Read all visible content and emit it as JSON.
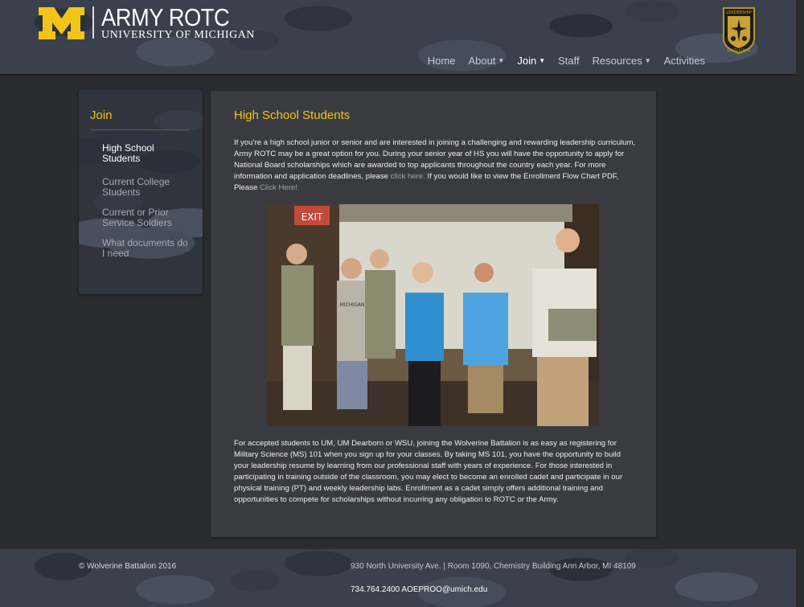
{
  "header": {
    "logo_title": "ARMY ROTC",
    "logo_subtitle": "UNIVERSITY OF MICHIGAN",
    "badge_top_text": "LEADERSHIP",
    "badge_bottom_text": "EXCELLENCE"
  },
  "nav": {
    "items": [
      {
        "label": "Home",
        "dropdown": false
      },
      {
        "label": "About",
        "dropdown": true
      },
      {
        "label": "Join",
        "dropdown": true,
        "active": true
      },
      {
        "label": "Staff",
        "dropdown": false
      },
      {
        "label": "Resources",
        "dropdown": true
      },
      {
        "label": "Activities",
        "dropdown": false
      }
    ],
    "caret_icon": "chevron-down-icon"
  },
  "sidebar": {
    "title": "Join",
    "items": [
      {
        "label": "High School Students",
        "current": true
      },
      {
        "label": "Current College Students"
      },
      {
        "label": "Current or Prior Service Soldiers"
      },
      {
        "label": "What documents do I need"
      }
    ]
  },
  "main": {
    "title": "High School Students",
    "p1_a": "If you’re a high school junior or senior and are interested in joining a challenging and rewarding leadership curriculum, Army ROTC may be a great option for you.  During your senior year of HS you will have the opportunity to apply for National Board scholarships which are awarded to top applicants throughout the country each year.  For more information and application deadlines, please ",
    "p1_link1": "click here.",
    "p1_b": " If you would like to view the Enrollment Flow Chart PDF, Please ",
    "p1_link2": "Click Here!",
    "photo_exit_sign": "EXIT",
    "photo_shirt_text": "MICHIGAN",
    "p2": "For accepted students to UM, UM Dearborn or WSU, joining the Wolverine Battalion is as easy as registering for Military Science (MS) 101 when you sign up for your classes. By taking MS 101, you have the opportunity to build your leadership resume by learning from our professional staff with years of experience.  For those interested in participating in training outside of the classroom, you may elect to become an enrolled cadet and participate in our physical training (PT) and weekly leadership labs.  Enrollment as a cadet simply offers additional training and opportunities to compete for scholarships without incurring any obligation to ROTC or the Army."
  },
  "footer": {
    "copyright": "© Wolverine Battalion 2016",
    "address": "930 North University Ave. | Room 1090, Chemistry Building Ann Arbor, MI 48109",
    "contact": "734.764.2400 AOEPROO@umich.edu"
  },
  "colors": {
    "accent": "#f3c418",
    "background": "#2b2c30",
    "panel": "#3a3b40"
  }
}
